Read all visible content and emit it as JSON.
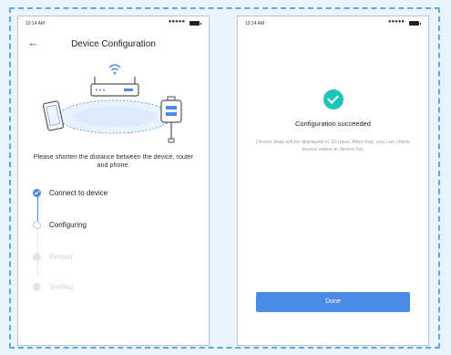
{
  "left_screen": {
    "status_time": "10:14 AM",
    "status_signal": "●●●●●",
    "title": "Device Configuration",
    "back_icon": "arrow-left-icon",
    "instruction": "Please shorten the distance between the device, router and phone.",
    "steps": [
      {
        "label": "Connect to device",
        "state": "done"
      },
      {
        "label": "Configuring",
        "state": "active"
      },
      {
        "label": "Restart",
        "state": "pending"
      },
      {
        "label": "Verified",
        "state": "pending"
      }
    ]
  },
  "right_screen": {
    "status_time": "10:14 AM",
    "status_signal": "●●●●●",
    "success_icon": "check-circle-icon",
    "success_title": "Configuration succeeded",
    "success_desc": "Device data will be displayed in 10 mins. After that, you can check device status in device list.",
    "done_label": "Done"
  },
  "colors": {
    "accent": "#4a8be8",
    "success": "#1fc3b8",
    "frame_border": "#5aa8e6",
    "background": "#e9f3fb"
  }
}
